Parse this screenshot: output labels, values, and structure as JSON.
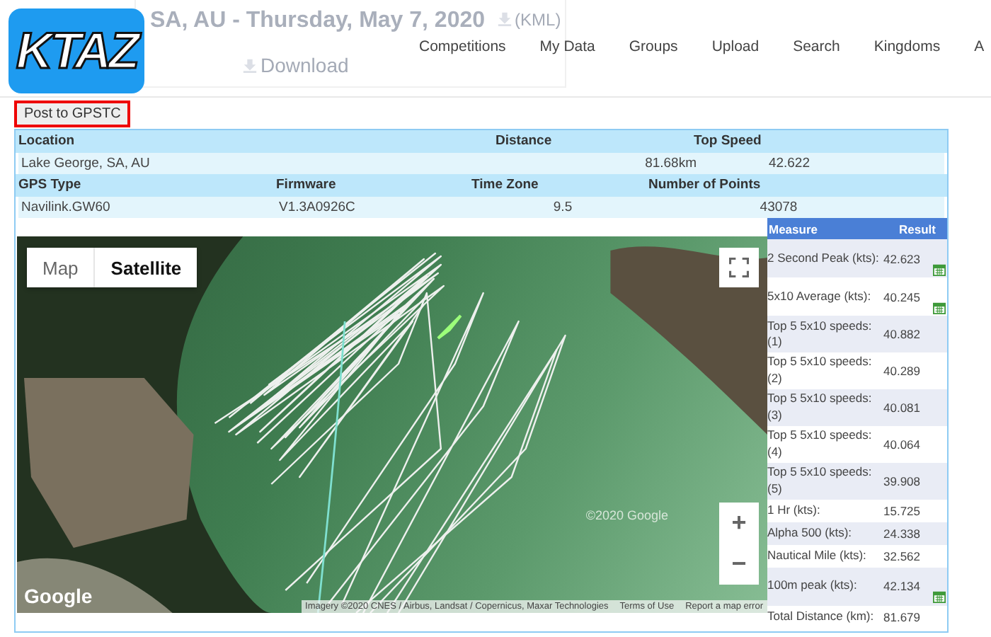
{
  "header": {
    "logo": "KTAZ",
    "title": "SA, AU - Thursday, May 7, 2020",
    "kml_link": "(KML)",
    "download_link": "Download",
    "nav": [
      "Competitions",
      "My Data",
      "Groups",
      "Upload",
      "Search",
      "Kingdoms",
      "A"
    ]
  },
  "post_button": {
    "label": "Post to GPSTC",
    "highlighted": true
  },
  "info": {
    "row_1": {
      "headers": [
        "Location",
        "Distance",
        "Top Speed"
      ],
      "values": [
        "Lake George, SA, AU",
        "81.68km",
        "42.622"
      ]
    },
    "row_2": {
      "headers": [
        "GPS Type",
        "Firmware",
        "Time Zone",
        "Number of Points"
      ],
      "values": [
        "Navilink.GW60",
        "V1.3A0926C",
        "9.5",
        "43078"
      ]
    }
  },
  "map": {
    "map_types": [
      {
        "label": "Map",
        "selected": false
      },
      {
        "label": "Satellite",
        "selected": true
      }
    ],
    "zoom_in": "+",
    "zoom_out": "−",
    "google": "Google",
    "watermark": "©2020 Google",
    "attribution": "Imagery ©2020 CNES / Airbus, Landsat / Copernicus, Maxar Technologies",
    "terms": "Terms of Use",
    "report": "Report a map error"
  },
  "results": {
    "columns": [
      "Measure",
      "Result"
    ],
    "rows": [
      {
        "measure": "2 Second Peak (kts):",
        "result": "42.623",
        "calendar": true
      },
      {
        "measure": "5x10 Average (kts):",
        "result": "40.245",
        "calendar": true
      },
      {
        "measure": "Top 5 5x10 speeds: (1)",
        "result": "40.882",
        "calendar": false
      },
      {
        "measure": "Top 5 5x10 speeds: (2)",
        "result": "40.289",
        "calendar": false
      },
      {
        "measure": "Top 5 5x10 speeds: (3)",
        "result": "40.081",
        "calendar": false
      },
      {
        "measure": "Top 5 5x10 speeds: (4)",
        "result": "40.064",
        "calendar": false
      },
      {
        "measure": "Top 5 5x10 speeds: (5)",
        "result": "39.908",
        "calendar": false
      },
      {
        "measure": "1 Hr (kts):",
        "result": "15.725",
        "calendar": false
      },
      {
        "measure": "Alpha 500 (kts):",
        "result": "24.338",
        "calendar": false
      },
      {
        "measure": "Nautical Mile (kts):",
        "result": "32.562",
        "calendar": false
      },
      {
        "measure": "100m peak (kts):",
        "result": "42.134",
        "calendar": true
      },
      {
        "measure": "Total Distance (km):",
        "result": "81.679",
        "calendar": false
      }
    ]
  }
}
